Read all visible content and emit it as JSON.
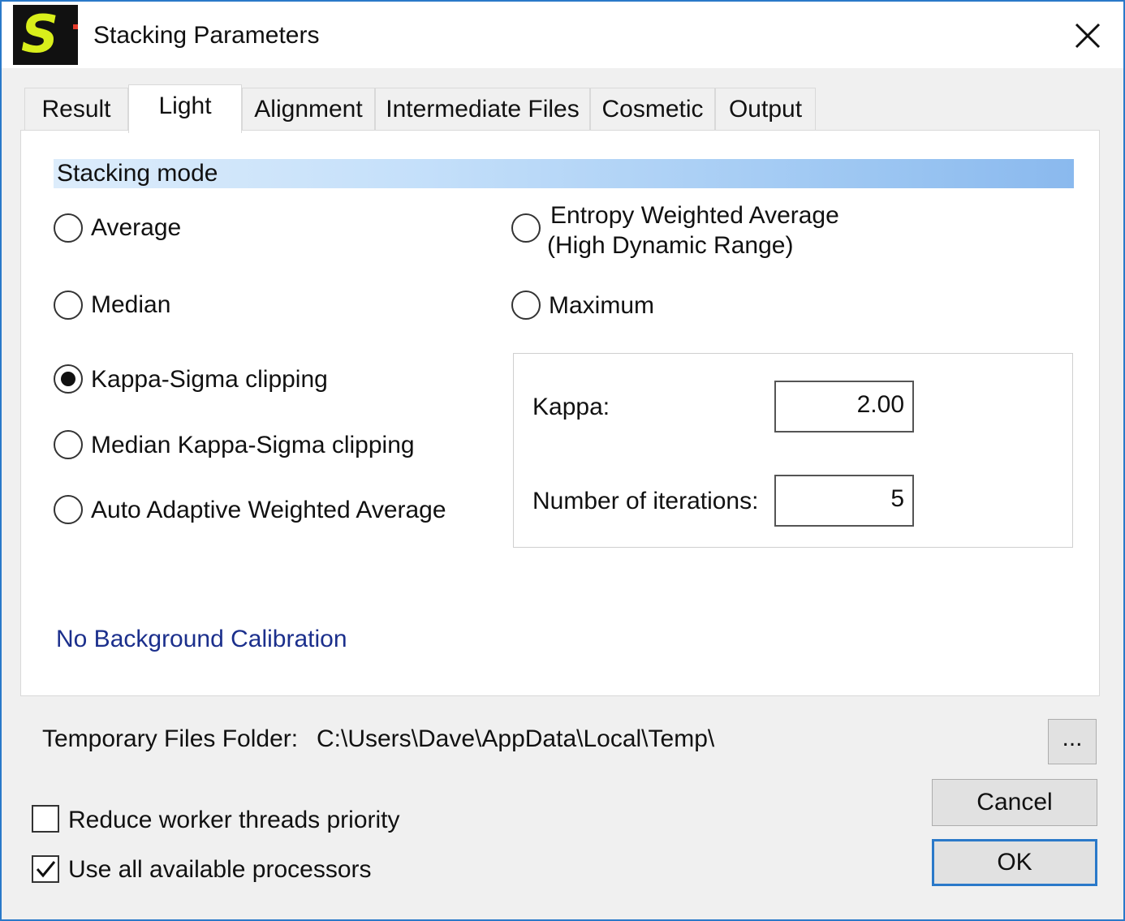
{
  "window": {
    "title": "Stacking Parameters",
    "app_icon_letter": "S"
  },
  "tabs": [
    {
      "label": "Result",
      "active": false
    },
    {
      "label": "Light",
      "active": true
    },
    {
      "label": "Alignment",
      "active": false
    },
    {
      "label": "Intermediate Files",
      "active": false
    },
    {
      "label": "Cosmetic",
      "active": false
    },
    {
      "label": "Output",
      "active": false
    }
  ],
  "stacking_mode": {
    "header": "Stacking mode",
    "options": {
      "average": {
        "label": "Average",
        "checked": false
      },
      "median": {
        "label": "Median",
        "checked": false
      },
      "kappa_sigma": {
        "label": "Kappa-Sigma clipping",
        "checked": true
      },
      "median_kappa_sigma": {
        "label": "Median Kappa-Sigma clipping",
        "checked": false
      },
      "auto_adaptive": {
        "label": "Auto Adaptive Weighted Average",
        "checked": false
      },
      "entropy": {
        "label_line1": "Entropy Weighted Average",
        "label_line2": "(High Dynamic Range)",
        "checked": false
      },
      "maximum": {
        "label": "Maximum",
        "checked": false
      }
    },
    "kappa": {
      "label": "Kappa:",
      "value": "2.00"
    },
    "iterations": {
      "label": "Number of iterations:",
      "value": "5"
    },
    "background_calibration_link": "No Background Calibration"
  },
  "temp_folder": {
    "label": "Temporary Files Folder:",
    "path": "C:\\Users\\Dave\\AppData\\Local\\Temp\\",
    "browse_label": "..."
  },
  "options": {
    "reduce_priority": {
      "label": "Reduce worker threads priority",
      "checked": false
    },
    "use_all_processors": {
      "label": "Use all available processors",
      "checked": true
    }
  },
  "buttons": {
    "cancel": "Cancel",
    "ok": "OK"
  },
  "colors": {
    "accent": "#2a79c9",
    "icon_yellow": "#d9ef1b",
    "link": "#1b2f8c"
  }
}
